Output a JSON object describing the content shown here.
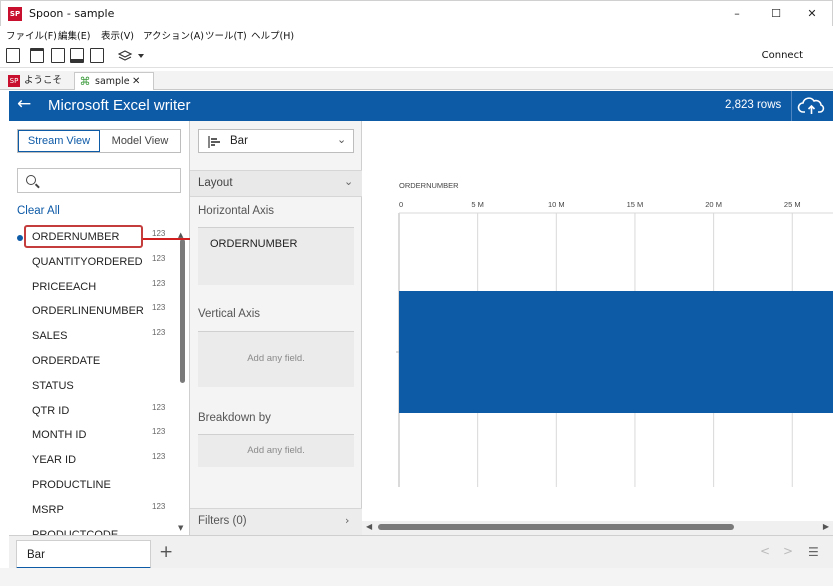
{
  "window": {
    "title": "Spoon - sample",
    "app_icon_text": "SP"
  },
  "window_controls": {
    "minimize": "–",
    "maximize": "☐",
    "close": "✕"
  },
  "menu": [
    "ファイル(F)",
    "編集(E)",
    "表示(V)",
    "アクション(A)",
    "ツール(T)",
    "ヘルプ(H)"
  ],
  "toolbar": {
    "connect_label": "Connect"
  },
  "file_tabs": [
    {
      "label": "ようこそ",
      "icon": "spoon-icon"
    },
    {
      "label": "sample",
      "icon": "transformation-icon",
      "close": "✕"
    }
  ],
  "header": {
    "back_icon": "←",
    "title": "Microsoft Excel writer",
    "rows": "2,823 rows",
    "upload_icon": "cloud-upload-icon"
  },
  "left_panel": {
    "stream_view": "Stream View",
    "model_view": "Model View",
    "search_placeholder": "",
    "clear_all": "Clear All",
    "fields": [
      {
        "name": "ORDERNUMBER",
        "numeric": true
      },
      {
        "name": "QUANTITYORDERED",
        "numeric": true
      },
      {
        "name": "PRICEEACH",
        "numeric": true
      },
      {
        "name": "ORDERLINENUMBER",
        "numeric": true
      },
      {
        "name": "SALES",
        "numeric": true
      },
      {
        "name": "ORDERDATE",
        "numeric": false
      },
      {
        "name": "STATUS",
        "numeric": false
      },
      {
        "name": "QTR ID",
        "numeric": true
      },
      {
        "name": "MONTH ID",
        "numeric": true
      },
      {
        "name": "YEAR ID",
        "numeric": true
      },
      {
        "name": "PRODUCTLINE",
        "numeric": false
      },
      {
        "name": "MSRP",
        "numeric": true
      },
      {
        "name": "PRODUCTCODE",
        "numeric": false
      }
    ],
    "numeric_badge": "123"
  },
  "middle_panel": {
    "chart_type": "Bar",
    "layout_label": "Layout",
    "horizontal_axis_label": "Horizontal Axis",
    "horizontal_axis_field": "ORDERNUMBER",
    "vertical_axis_label": "Vertical Axis",
    "vertical_axis_hint": "Add any field.",
    "breakdown_label": "Breakdown by",
    "breakdown_hint": "Add any field.",
    "filters_label": "Filters (0)"
  },
  "chart_data": {
    "type": "bar",
    "orientation": "horizontal",
    "xlabel": "ORDERNUMBER",
    "x_ticks": [
      "0",
      "5 M",
      "10 M",
      "15 M",
      "20 M",
      "25 M"
    ],
    "categories": [
      ""
    ],
    "values": [
      29000000
    ],
    "xlim": [
      0,
      26000000
    ],
    "bar_color": "#0d5aa7",
    "grid": true
  },
  "bottom": {
    "tab_label": "Bar",
    "add_label": "+",
    "prev": "<",
    "next": ">",
    "list_icon": "☰"
  },
  "colors": {
    "accent": "#0d5aa7",
    "highlight": "#c43c3c"
  }
}
